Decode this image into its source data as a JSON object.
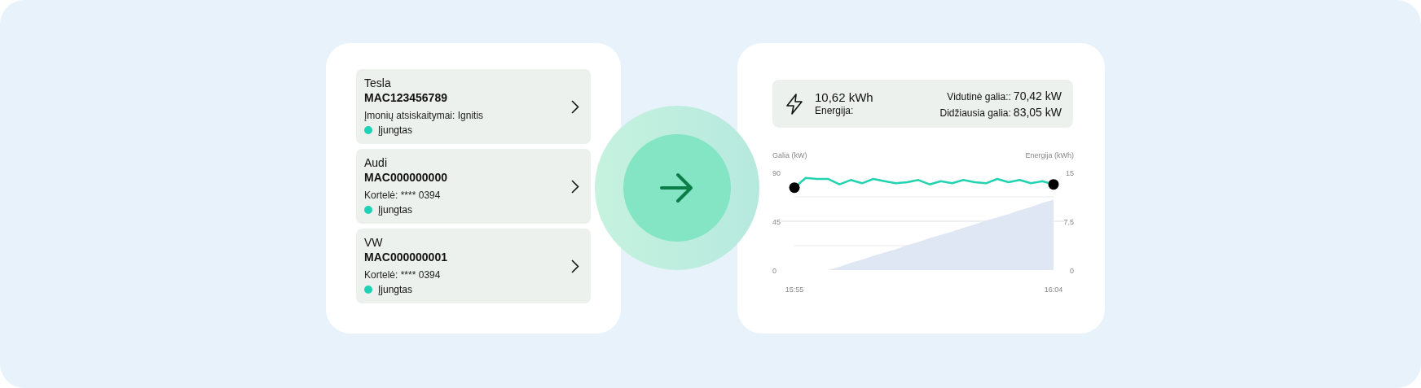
{
  "vehicles": [
    {
      "name": "Tesla",
      "id": "MAC123456789",
      "detail": "Įmonių atsiskaitymai: Ignitis",
      "status": "Įjungtas",
      "color": "#1ed3b5"
    },
    {
      "name": "Audi",
      "id": "MAC000000000",
      "detail": "Kortelė: **** 0394",
      "status": "Įjungtas",
      "color": "#1ed3b5"
    },
    {
      "name": "VW",
      "id": "MAC000000001",
      "detail": "Kortelė: **** 0394",
      "status": "Įjungtas",
      "color": "#1ed3b5"
    }
  ],
  "summary": {
    "energy_value": "10,62 kWh",
    "energy_label": "Energija:",
    "stats": [
      {
        "label": "Vidutinė galia::",
        "value": "70,42 kW"
      },
      {
        "label": "Didžiausia galia:",
        "value": "83,05 kW"
      }
    ]
  },
  "chart_data": {
    "type": "line",
    "ylabel": "Galia (kW)",
    "y2label": "Energija (kWh)",
    "categories": [
      "15:55",
      null,
      null,
      null,
      null,
      null,
      null,
      null,
      null,
      null,
      null,
      null,
      null,
      null,
      null,
      null,
      null,
      null,
      null,
      null,
      null,
      null,
      null,
      "16:04"
    ],
    "ylim": [
      0,
      90
    ],
    "yticks": [
      0,
      45,
      90
    ],
    "ref_lines": [
      {
        "axis": "y",
        "value": 22.5
      },
      {
        "axis": "y",
        "value": 67.5
      }
    ],
    "y2lim": [
      0,
      15
    ],
    "y2ticks": [
      0,
      7.5,
      15
    ],
    "series": [
      {
        "type": "line",
        "color": "#22d3b0",
        "values": [
          76,
          85,
          84,
          84,
          79,
          83,
          80,
          84,
          82,
          80,
          81,
          83,
          79,
          82,
          80,
          83,
          81,
          80,
          84,
          81,
          83,
          80,
          82,
          79
        ]
      },
      {
        "type": "area",
        "axis": "y2",
        "color": "#dfe7f4",
        "values": [
          0,
          0,
          0,
          0,
          0.5,
          1.1,
          1.6,
          2.2,
          2.7,
          3.2,
          3.8,
          4.3,
          4.9,
          5.4,
          5.9,
          6.5,
          7,
          7.6,
          8.1,
          8.6,
          9.2,
          9.7,
          10.3,
          10.8
        ]
      }
    ]
  }
}
